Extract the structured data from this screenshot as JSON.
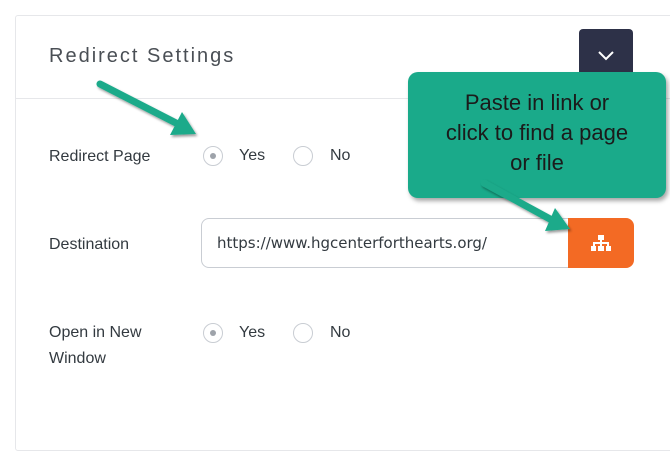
{
  "panel": {
    "title": "Redirect Settings"
  },
  "fields": {
    "redirect_page": {
      "label": "Redirect Page",
      "options": [
        "Yes",
        "No"
      ],
      "selected": "Yes"
    },
    "destination": {
      "label": "Destination",
      "value": "https://www.hgcenterforthearts.org/"
    },
    "open_new_window": {
      "label_line1": "Open in New",
      "label_line2": "Window",
      "options": [
        "Yes",
        "No"
      ],
      "selected": "Yes"
    }
  },
  "callout": {
    "lines": [
      "Paste in link or",
      "click to find a page",
      "or file"
    ]
  },
  "colors": {
    "accent_orange": "#f36a24",
    "collapse_button": "#2d3148",
    "callout_teal": "#1aaa8a"
  },
  "icons": {
    "collapse": "chevron-down-icon",
    "sitemap": "sitemap-icon"
  }
}
